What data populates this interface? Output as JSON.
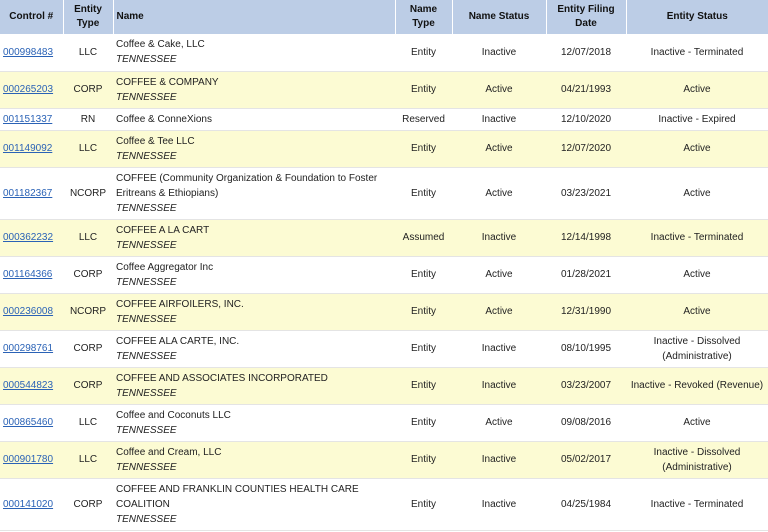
{
  "headers": {
    "control": "Control #",
    "entity_type": "Entity Type",
    "name": "Name",
    "name_type": "Name Type",
    "name_status": "Name Status",
    "filing_date": "Entity Filing Date",
    "entity_status": "Entity Status"
  },
  "rows": [
    {
      "control": "000998483",
      "etype": "LLC",
      "name": "Coffee & Cake, LLC",
      "state": "TENNESSEE",
      "ntype": "Entity",
      "nstatus": "Inactive",
      "date": "12/07/2018",
      "estatus": "Inactive - Terminated"
    },
    {
      "control": "000265203",
      "etype": "CORP",
      "name": "COFFEE & COMPANY",
      "state": "TENNESSEE",
      "ntype": "Entity",
      "nstatus": "Active",
      "date": "04/21/1993",
      "estatus": "Active"
    },
    {
      "control": "001151337",
      "etype": "RN",
      "name": "Coffee & ConneXions",
      "state": "",
      "ntype": "Reserved",
      "nstatus": "Inactive",
      "date": "12/10/2020",
      "estatus": "Inactive - Expired"
    },
    {
      "control": "001149092",
      "etype": "LLC",
      "name": "Coffee & Tee LLC",
      "state": "TENNESSEE",
      "ntype": "Entity",
      "nstatus": "Active",
      "date": "12/07/2020",
      "estatus": "Active"
    },
    {
      "control": "001182367",
      "etype": "NCORP",
      "name": "COFFEE (Community Organization & Foundation to Foster Eritreans & Ethiopians)",
      "state": "TENNESSEE",
      "ntype": "Entity",
      "nstatus": "Active",
      "date": "03/23/2021",
      "estatus": "Active"
    },
    {
      "control": "000362232",
      "etype": "LLC",
      "name": "COFFEE A LA CART",
      "state": "TENNESSEE",
      "ntype": "Assumed",
      "nstatus": "Inactive",
      "date": "12/14/1998",
      "estatus": "Inactive - Terminated"
    },
    {
      "control": "001164366",
      "etype": "CORP",
      "name": "Coffee Aggregator Inc",
      "state": "TENNESSEE",
      "ntype": "Entity",
      "nstatus": "Active",
      "date": "01/28/2021",
      "estatus": "Active"
    },
    {
      "control": "000236008",
      "etype": "NCORP",
      "name": "COFFEE AIRFOILERS, INC.",
      "state": "TENNESSEE",
      "ntype": "Entity",
      "nstatus": "Active",
      "date": "12/31/1990",
      "estatus": "Active"
    },
    {
      "control": "000298761",
      "etype": "CORP",
      "name": "COFFEE ALA CARTE, INC.",
      "state": "TENNESSEE",
      "ntype": "Entity",
      "nstatus": "Inactive",
      "date": "08/10/1995",
      "estatus": "Inactive - Dissolved (Administrative)"
    },
    {
      "control": "000544823",
      "etype": "CORP",
      "name": "COFFEE AND ASSOCIATES INCORPORATED",
      "state": "TENNESSEE",
      "ntype": "Entity",
      "nstatus": "Inactive",
      "date": "03/23/2007",
      "estatus": "Inactive - Revoked (Revenue)"
    },
    {
      "control": "000865460",
      "etype": "LLC",
      "name": "Coffee and Coconuts LLC",
      "state": "TENNESSEE",
      "ntype": "Entity",
      "nstatus": "Active",
      "date": "09/08/2016",
      "estatus": "Active"
    },
    {
      "control": "000901780",
      "etype": "LLC",
      "name": "Coffee and Cream, LLC",
      "state": "TENNESSEE",
      "ntype": "Entity",
      "nstatus": "Inactive",
      "date": "05/02/2017",
      "estatus": "Inactive - Dissolved (Administrative)"
    },
    {
      "control": "000141020",
      "etype": "CORP",
      "name": "COFFEE AND FRANKLIN COUNTIES HEALTH CARE COALITION",
      "state": "TENNESSEE",
      "ntype": "Entity",
      "nstatus": "Inactive",
      "date": "04/25/1984",
      "estatus": "Inactive - Terminated"
    }
  ],
  "colors": {
    "header_bg": "#bccde6",
    "alt_row_bg": "#fcfbd3",
    "link": "#2a62b6"
  }
}
